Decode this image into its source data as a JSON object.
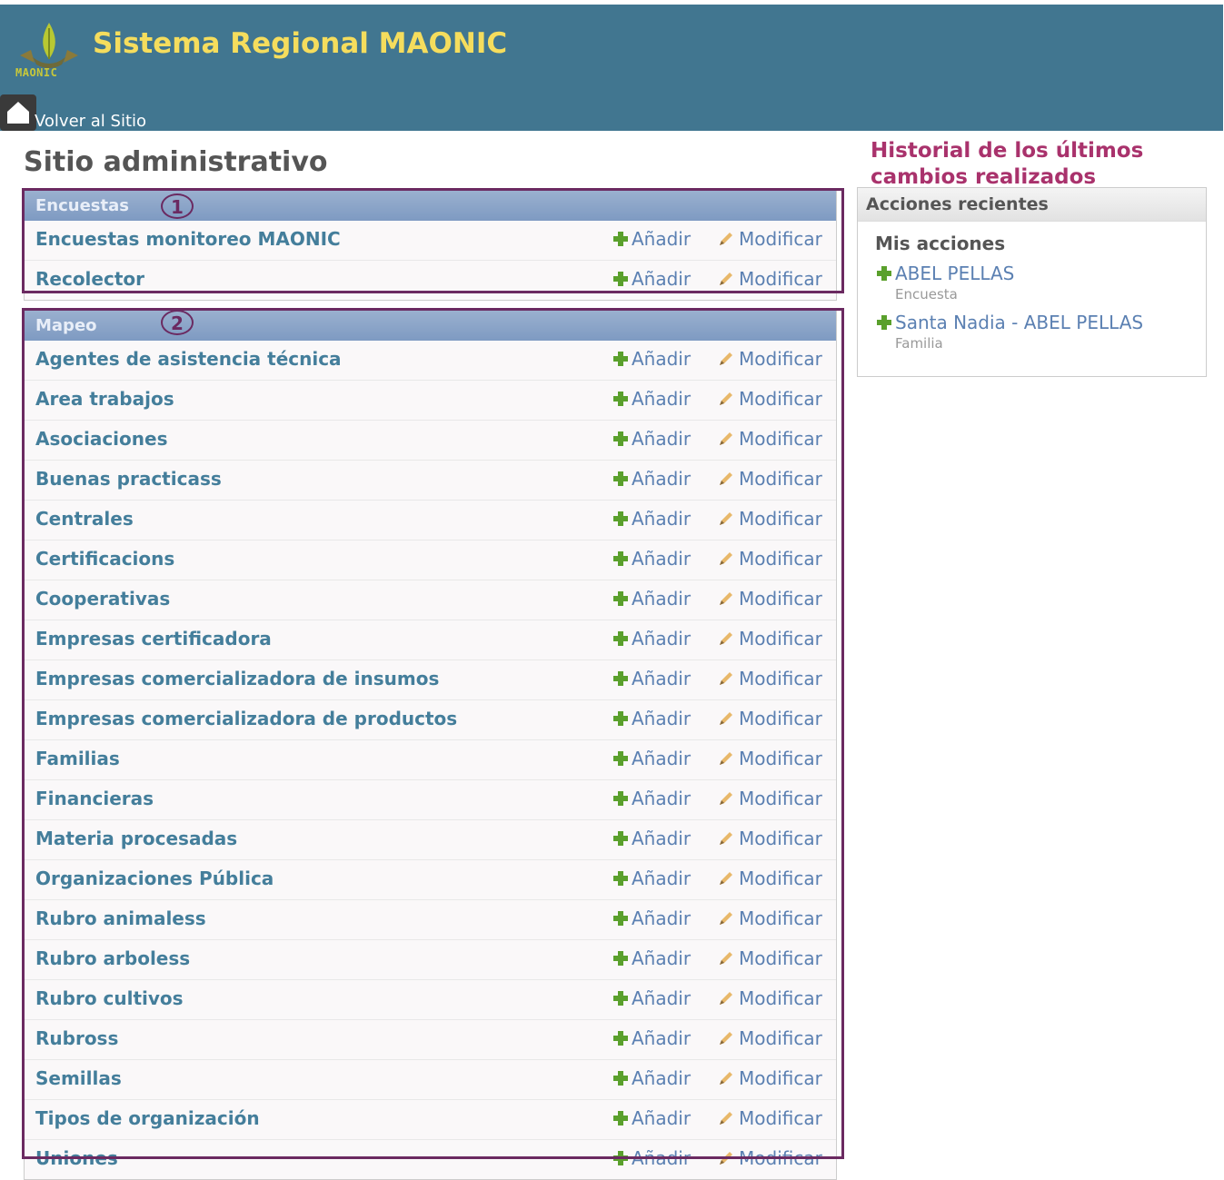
{
  "header": {
    "title": "Sistema Regional MAONIC",
    "logo_text": "MAONIC",
    "back_link": "Volver al Sitio"
  },
  "page_title": "Sitio administrativo",
  "annotations": {
    "history_note": "Historial de los últimos cambios realizados",
    "marker_1": "1",
    "marker_2": "2"
  },
  "modules": [
    {
      "caption": "Encuestas",
      "rows": [
        {
          "name": "Encuestas monitoreo MAONIC",
          "add": "Añadir",
          "change": "Modificar"
        },
        {
          "name": "Recolector",
          "add": "Añadir",
          "change": "Modificar"
        }
      ]
    },
    {
      "caption": "Mapeo",
      "rows": [
        {
          "name": "Agentes de asistencia técnica",
          "add": "Añadir",
          "change": "Modificar"
        },
        {
          "name": "Area trabajos",
          "add": "Añadir",
          "change": "Modificar"
        },
        {
          "name": "Asociaciones",
          "add": "Añadir",
          "change": "Modificar"
        },
        {
          "name": "Buenas practicass",
          "add": "Añadir",
          "change": "Modificar"
        },
        {
          "name": "Centrales",
          "add": "Añadir",
          "change": "Modificar"
        },
        {
          "name": "Certificacions",
          "add": "Añadir",
          "change": "Modificar"
        },
        {
          "name": "Cooperativas",
          "add": "Añadir",
          "change": "Modificar"
        },
        {
          "name": "Empresas certificadora",
          "add": "Añadir",
          "change": "Modificar"
        },
        {
          "name": "Empresas comercializadora de insumos",
          "add": "Añadir",
          "change": "Modificar"
        },
        {
          "name": "Empresas comercializadora de productos",
          "add": "Añadir",
          "change": "Modificar"
        },
        {
          "name": "Familias",
          "add": "Añadir",
          "change": "Modificar"
        },
        {
          "name": "Financieras",
          "add": "Añadir",
          "change": "Modificar"
        },
        {
          "name": "Materia procesadas",
          "add": "Añadir",
          "change": "Modificar"
        },
        {
          "name": "Organizaciones Pública",
          "add": "Añadir",
          "change": "Modificar"
        },
        {
          "name": "Rubro animaless",
          "add": "Añadir",
          "change": "Modificar"
        },
        {
          "name": "Rubro arboless",
          "add": "Añadir",
          "change": "Modificar"
        },
        {
          "name": "Rubro cultivos",
          "add": "Añadir",
          "change": "Modificar"
        },
        {
          "name": "Rubross",
          "add": "Añadir",
          "change": "Modificar"
        },
        {
          "name": "Semillas",
          "add": "Añadir",
          "change": "Modificar"
        },
        {
          "name": "Tipos de organización",
          "add": "Añadir",
          "change": "Modificar"
        },
        {
          "name": "Uniones",
          "add": "Añadir",
          "change": "Modificar"
        }
      ]
    }
  ],
  "recent_actions": {
    "caption": "Acciones recientes",
    "subtitle": "Mis acciones",
    "items": [
      {
        "label": "ABEL PELLAS",
        "type": "Encuesta"
      },
      {
        "label": "Santa Nadia - ABEL PELLAS",
        "type": "Familia"
      }
    ]
  },
  "colors": {
    "header_bg": "#417690",
    "title_yellow": "#f5dd5d",
    "link": "#447e9b",
    "annotation": "#6b2a61",
    "annotation_text": "#a9326c",
    "add_green": "#5aa02c"
  }
}
